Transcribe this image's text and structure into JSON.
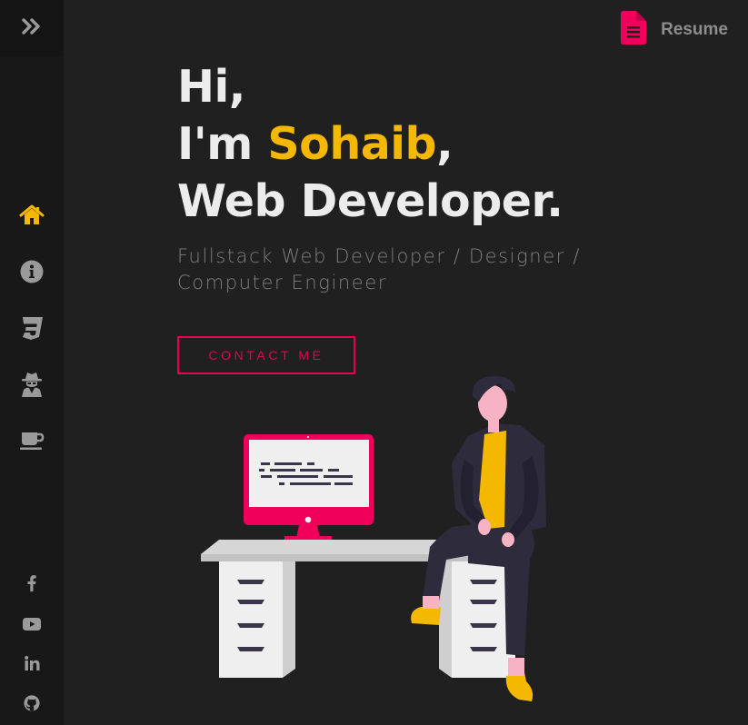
{
  "header": {
    "resume_label": "Resume"
  },
  "sidebar": {
    "toggle_icon": "chevrons-right-icon",
    "nav": [
      {
        "name": "home",
        "icon": "home-icon",
        "active": true
      },
      {
        "name": "about",
        "icon": "info-icon",
        "active": false
      },
      {
        "name": "skills",
        "icon": "css3-icon",
        "active": false
      },
      {
        "name": "hacker",
        "icon": "user-secret-icon",
        "active": false
      },
      {
        "name": "coffee",
        "icon": "coffee-icon",
        "active": false
      }
    ],
    "social": [
      {
        "name": "facebook",
        "icon": "facebook-icon"
      },
      {
        "name": "youtube",
        "icon": "youtube-icon"
      },
      {
        "name": "linkedin",
        "icon": "linkedin-icon"
      },
      {
        "name": "github",
        "icon": "github-icon"
      }
    ]
  },
  "hero": {
    "greeting": "Hi,",
    "intro_prefix": "I'm ",
    "name": "Sohaib",
    "intro_suffix": ",",
    "role": "Web Developer.",
    "subtitle": "Fullstack Web Developer / Designer / Computer Engineer",
    "cta_label": "CONTACT ME"
  },
  "colors": {
    "accent_yellow": "#f5b800",
    "accent_pink": "#e8004f",
    "background": "#202020",
    "sidebar": "#181818"
  }
}
